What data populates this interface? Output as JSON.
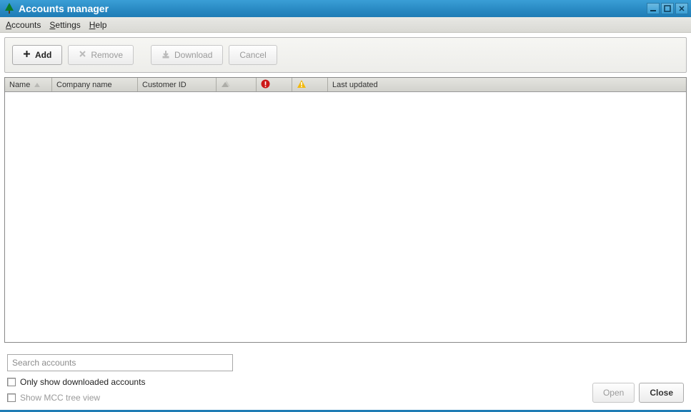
{
  "window": {
    "title": "Accounts manager"
  },
  "menubar": {
    "accounts": "Accounts",
    "settings": "Settings",
    "help": "Help"
  },
  "toolbar": {
    "add": "Add",
    "remove": "Remove",
    "download": "Download",
    "cancel": "Cancel"
  },
  "table": {
    "headers": {
      "name": "Name",
      "company": "Company name",
      "customer_id": "Customer ID",
      "last_updated": "Last updated"
    }
  },
  "search": {
    "placeholder": "Search accounts"
  },
  "checks": {
    "only_downloaded": "Only show downloaded accounts",
    "mcc_tree": "Show MCC tree view"
  },
  "footer": {
    "open": "Open",
    "close": "Close"
  }
}
